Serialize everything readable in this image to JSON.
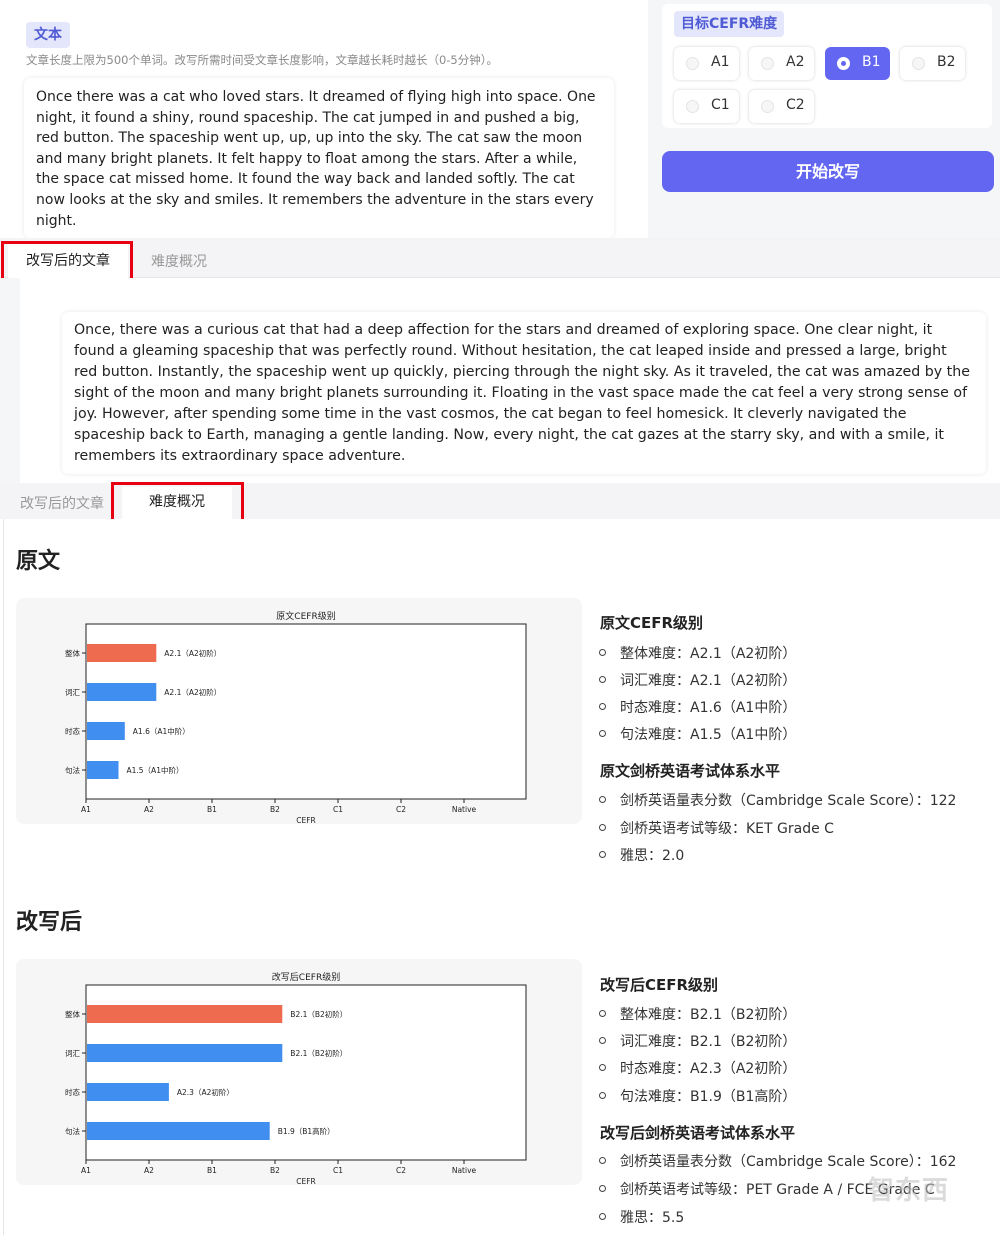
{
  "input": {
    "section_label": "文本",
    "hint": "文章长度上限为500个单词。改写所需时间受文章长度影响，文章越长耗时越长（0-5分钟）。",
    "original_text": "Once there was a cat who loved stars. It dreamed of flying high into space. One night, it found a shiny, round spaceship. The cat jumped in and pushed a big, red button. The spaceship went up, up, up into the sky. The cat saw the moon and many bright planets. It felt happy to float among the stars. After a while, the space cat missed home. It found the way back and landed softly. The cat now looks at the sky and smiles. It remembers the adventure in the stars every night."
  },
  "target": {
    "title": "目标CEFR难度",
    "levels": [
      "A1",
      "A2",
      "B1",
      "B2",
      "C1",
      "C2"
    ],
    "selected": "B1",
    "start_button": "开始改写"
  },
  "tabs": {
    "rewritten": "改写后的文章",
    "overview": "难度概况"
  },
  "rewritten_text": "Once, there was a curious cat that had a deep affection for the stars and dreamed of exploring space. One clear night, it found a gleaming spaceship that was perfectly round. Without hesitation, the cat leaped inside and pressed a large, bright red button. Instantly, the spaceship went up quickly, piercing through the night sky. As it traveled, the cat was amazed by the sight of the moon and many bright planets surrounding it. Floating in the vast space made the cat feel a very strong sense of joy. However, after spending some time in the vast cosmos, the cat began to feel homesick. It cleverly navigated the spaceship back to Earth, managing a gentle landing. Now, every night, the cat gazes at the starry sky, and with a smile, it remembers its extraordinary space adventure.",
  "original_section": {
    "title": "原文",
    "cefr_heading": "原文CEFR级别",
    "cefr_items": [
      "整体难度：A2.1（A2初阶）",
      "词汇难度：A2.1（A2初阶）",
      "时态难度：A1.6（A1中阶）",
      "句法难度：A1.5（A1中阶）"
    ],
    "cambridge_heading": "原文剑桥英语考试体系水平",
    "cambridge_items": [
      "剑桥英语量表分数（Cambridge Scale Score）：122",
      "剑桥英语考试等级：KET Grade C",
      "雅思：2.0"
    ]
  },
  "rewritten_section": {
    "title": "改写后",
    "cefr_heading": "改写后CEFR级别",
    "cefr_items": [
      "整体难度：B2.1（B2初阶）",
      "词汇难度：B2.1（B2初阶）",
      "时态难度：A2.3（A2初阶）",
      "句法难度：B1.9（B1高阶）"
    ],
    "cambridge_heading": "改写后剑桥英语考试体系水平",
    "cambridge_items": [
      "剑桥英语量表分数（Cambridge Scale Score）：162",
      "剑桥英语考试等级：PET Grade A / FCE Grade C",
      "雅思：5.5"
    ]
  },
  "colors": {
    "accent": "#6366f1",
    "overall_bar": "#ee6b50",
    "bar": "#3f8ef0",
    "highlight_box": "#e60012"
  },
  "chart_data": [
    {
      "type": "bar",
      "orientation": "horizontal",
      "title": "原文CEFR级别",
      "xlabel": "CEFR",
      "ylabel": "",
      "x_ticks": [
        "A1",
        "A2",
        "B1",
        "B2",
        "C1",
        "C2",
        "Native"
      ],
      "xlim": [
        0,
        7
      ],
      "categories": [
        "整体",
        "词汇",
        "时态",
        "句法"
      ],
      "values": [
        1.1,
        1.1,
        0.6,
        0.5
      ],
      "labels": [
        "A2.1（A2初阶）",
        "A2.1（A2初阶）",
        "A1.6（A1中阶）",
        "A1.5（A1中阶）"
      ]
    },
    {
      "type": "bar",
      "orientation": "horizontal",
      "title": "改写后CEFR级别",
      "xlabel": "CEFR",
      "ylabel": "",
      "x_ticks": [
        "A1",
        "A2",
        "B1",
        "B2",
        "C1",
        "C2",
        "Native"
      ],
      "xlim": [
        0,
        7
      ],
      "categories": [
        "整体",
        "词汇",
        "时态",
        "句法"
      ],
      "values": [
        3.1,
        3.1,
        1.3,
        2.9
      ],
      "labels": [
        "B2.1（B2初阶）",
        "B2.1（B2初阶）",
        "A2.3（A2初阶）",
        "B1.9（B1高阶）"
      ]
    }
  ],
  "watermark": "智东西"
}
